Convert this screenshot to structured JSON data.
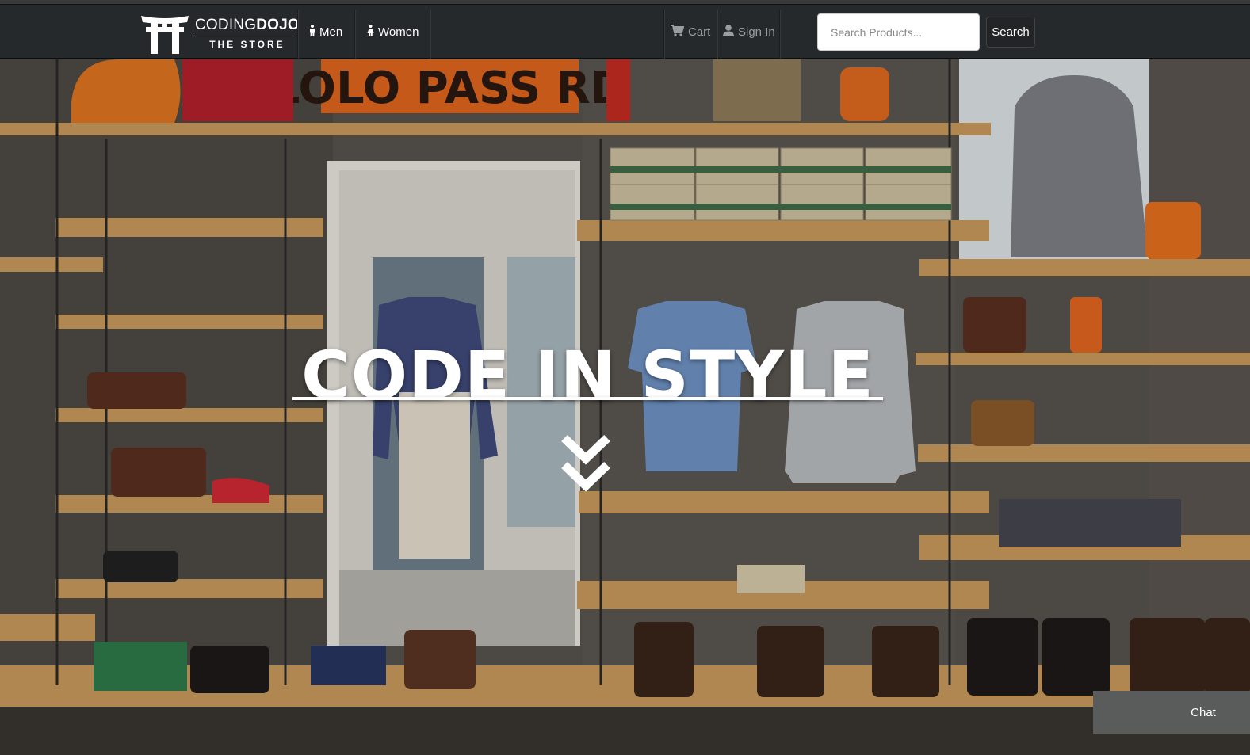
{
  "brand": {
    "name_part1": "CODING",
    "name_part2": "DOJO",
    "subtitle": "THE STORE"
  },
  "nav": {
    "men_label": "Men",
    "women_label": "Women",
    "cart_label": "Cart",
    "signin_label": "Sign In",
    "men_icon": "male-icon",
    "women_icon": "female-icon",
    "cart_icon": "shopping-cart-icon",
    "signin_icon": "user-icon"
  },
  "search": {
    "placeholder": "Search Products...",
    "value": "",
    "button_label": "Search"
  },
  "hero": {
    "title": "CODE IN STYLE",
    "scroll_icon": "double-chevron-down-icon",
    "store_sign": "LOLO PASS RD"
  },
  "chat": {
    "label": "Chat"
  },
  "colors": {
    "navbar_bg": "#26292b",
    "hero_text": "#ffffff",
    "chat_bg": "#5a5b5b"
  }
}
